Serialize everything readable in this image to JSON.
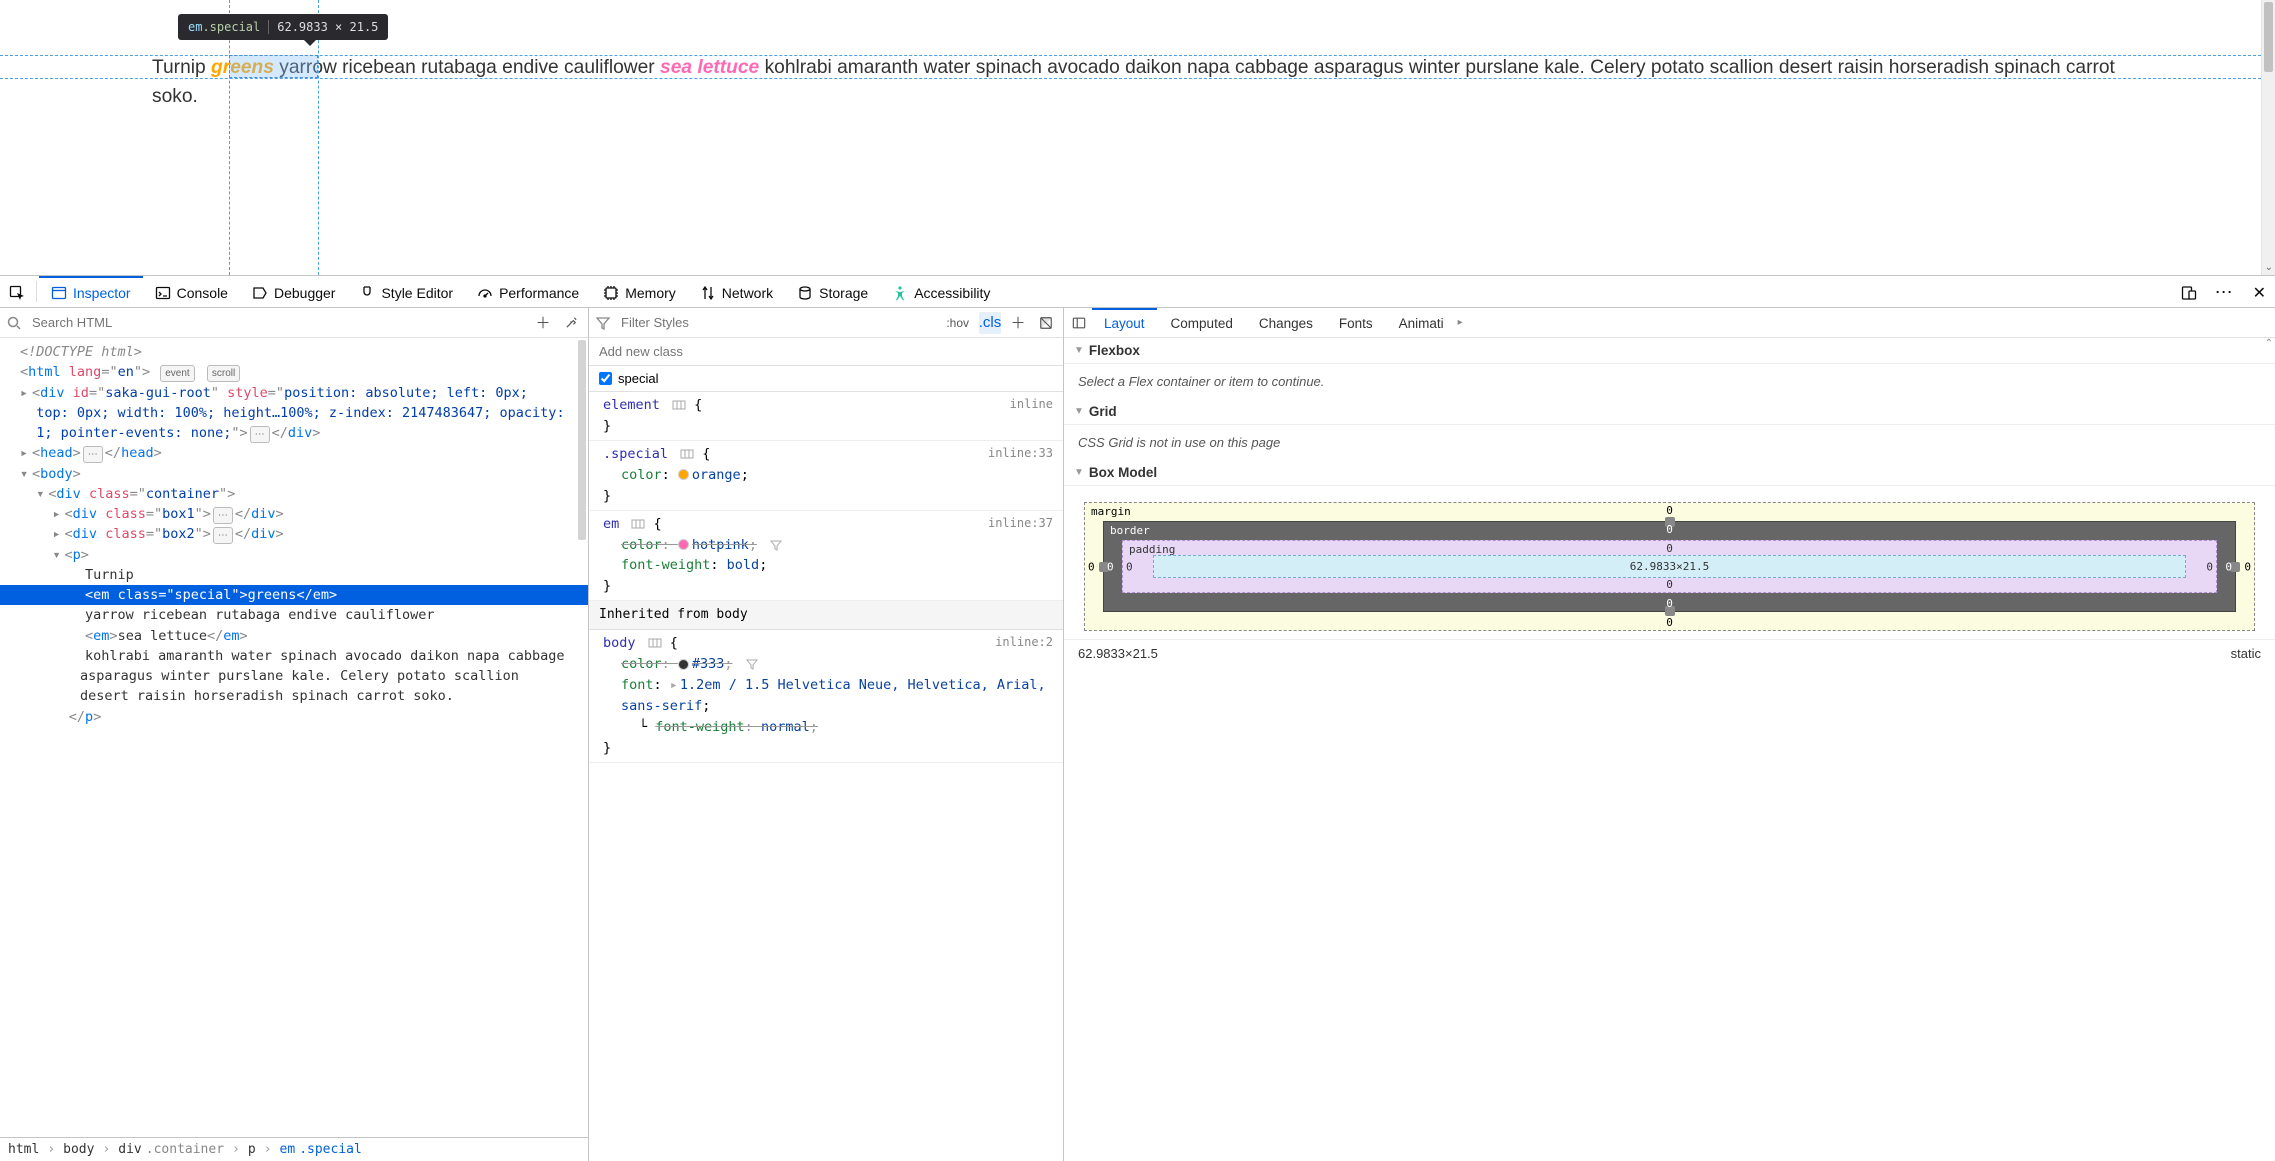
{
  "page": {
    "p_text_1": "Turnip ",
    "em_special": "greens",
    "p_text_2": " yarrow ricebean rutabaga endive cauliflower ",
    "em_plain": "sea lettuce",
    "p_text_3": " kohlrabi amaranth water spinach avocado daikon napa cabbage asparagus winter purslane kale. Celery potato scallion desert raisin horseradish spinach carrot soko."
  },
  "tooltip": {
    "tag": "em",
    "class": ".special",
    "dims": "62.9833 × 21.5"
  },
  "toolbar": {
    "tabs": [
      "Inspector",
      "Console",
      "Debugger",
      "Style Editor",
      "Performance",
      "Memory",
      "Network",
      "Storage",
      "Accessibility"
    ]
  },
  "search_html_placeholder": "Search HTML",
  "filter_styles_placeholder": "Filter Styles",
  "hov_label": ":hov",
  "cls_label": ".cls",
  "add_class_placeholder": "Add new class",
  "class_toggle": "special",
  "markup": {
    "doctype": "<!DOCTYPE html>",
    "html_open": "<html lang=\"en\">",
    "badges": {
      "event": "event",
      "scroll": "scroll"
    },
    "saka_line": "<div id=\"saka-gui-root\" style=\"position: absolute; left: 0px; top: 0px; width: 100%; height…100%; z-index: 2147483647; opacity: 1; pointer-events: none;\">",
    "saka_close": "</div>",
    "head": "<head>",
    "head_close": "</head>",
    "body": "<body>",
    "container": "<div class=\"container\">",
    "box1": "<div class=\"box1\">",
    "box2": "<div class=\"box2\">",
    "div_close": "</div>",
    "p_open": "<p>",
    "p_close": "</p>",
    "turnip": "Turnip",
    "selected": "<em class=\"special\">greens</em>",
    "yarrow": "yarrow ricebean rutabaga endive cauliflower",
    "sea": "<em>sea lettuce</em>",
    "rest": "kohlrabi amaranth water spinach avocado daikon napa cabbage asparagus winter purslane kale. Celery potato scallion desert raisin horseradish spinach carrot soko."
  },
  "breadcrumbs": [
    "html",
    "body",
    "div.container",
    "p",
    "em.special"
  ],
  "rules": {
    "element_sel": "element",
    "element_src": "inline",
    "special_sel": ".special",
    "special_src": "inline:33",
    "special_prop": "color",
    "special_val": "orange",
    "em_sel": "em",
    "em_src": "inline:37",
    "em_color_prop": "color",
    "em_color_val": "hotpink",
    "em_fw_prop": "font-weight",
    "em_fw_val": "bold",
    "inherit_label": "Inherited from body",
    "body_sel": "body",
    "body_src": "inline:2",
    "body_color_prop": "color",
    "body_color_val": "#333",
    "body_font_prop": "font",
    "body_font_val": "1.2em / 1.5 Helvetica Neue, Helvetica, Arial, sans-serif",
    "body_fw_prop": "font-weight",
    "body_fw_val": "normal"
  },
  "layout_tabs": [
    "Layout",
    "Computed",
    "Changes",
    "Fonts",
    "Animati"
  ],
  "flexbox": {
    "title": "Flexbox",
    "msg": "Select a Flex container or item to continue."
  },
  "grid": {
    "title": "Grid",
    "msg": "CSS Grid is not in use on this page"
  },
  "boxmodel": {
    "title": "Box Model",
    "margin_label": "margin",
    "border_label": "border",
    "padding_label": "padding",
    "content": "62.9833×21.5",
    "zero": "0",
    "footer_dims": "62.9833×21.5",
    "footer_pos": "static"
  }
}
